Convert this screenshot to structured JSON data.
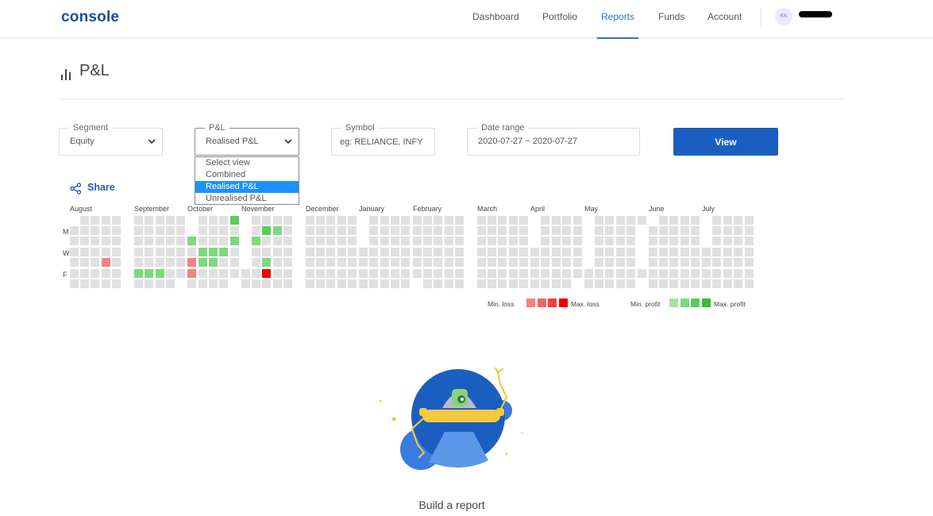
{
  "app": {
    "logo": "console",
    "nav": [
      "Dashboard",
      "Portfolio",
      "Reports",
      "Funds",
      "Account"
    ],
    "active_nav": "Reports",
    "avatar_initials": "KK"
  },
  "page": {
    "title": "P&L"
  },
  "filters": {
    "segment": {
      "label": "Segment",
      "value": "Equity"
    },
    "pnl": {
      "label": "P&L",
      "value": "Realised P&L",
      "options": [
        "Select view",
        "Combined",
        "Realised P&L",
        "Unrealised P&L"
      ],
      "selected_index": 2
    },
    "symbol": {
      "label": "Symbol",
      "placeholder": "eg: RELIANCE, INFY"
    },
    "date_range": {
      "label": "Date range",
      "value": "2020-07-27 ~ 2020-07-27"
    },
    "view_button": "View"
  },
  "share_label": "Share",
  "heatmap": {
    "months": [
      "August",
      "September",
      "October",
      "November",
      "December",
      "January",
      "February",
      "March",
      "April",
      "May",
      "June",
      "July"
    ],
    "day_labels": [
      "M",
      "W",
      "F"
    ],
    "legend": {
      "min_loss": "Min. loss",
      "max_loss": "Max. loss",
      "min_profit": "Min. profit",
      "max_profit": "Max. profit"
    },
    "colors": {
      "empty": "#e0e0e0",
      "loss": [
        "#f88080",
        "#f56565",
        "#f04040",
        "#ee0000"
      ],
      "profit": [
        "#a2e4a2",
        "#7fd87f",
        "#5acc5a",
        "#33c033"
      ]
    }
  },
  "empty_state": {
    "text": "Build a report"
  }
}
